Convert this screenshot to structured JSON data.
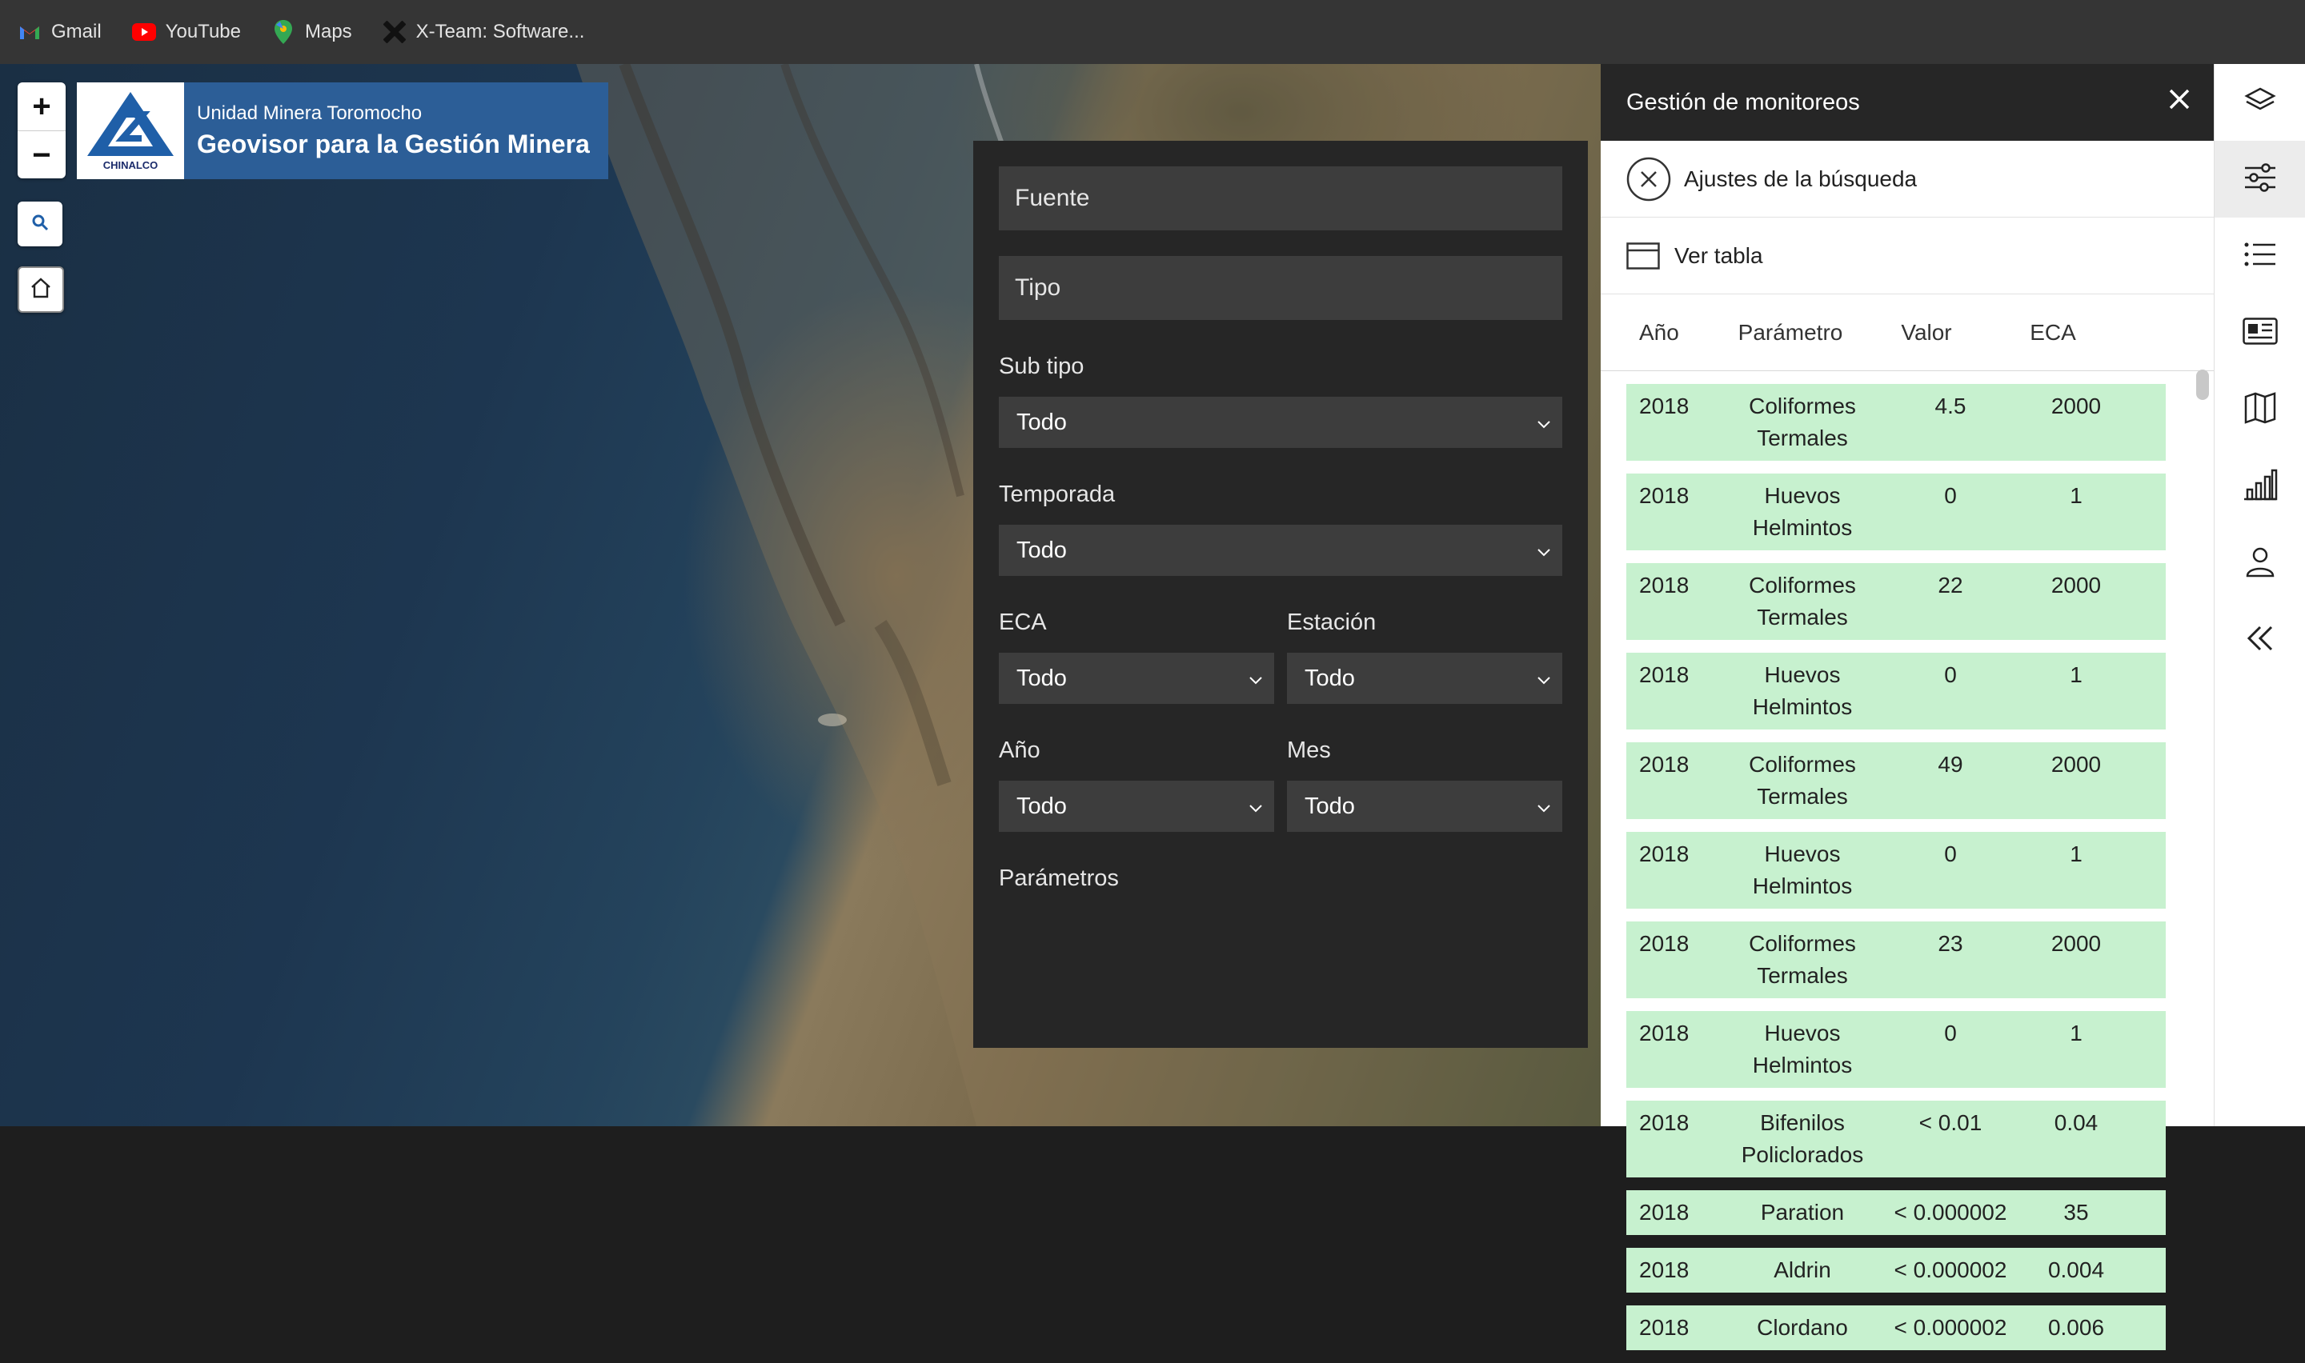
{
  "bookmarks": [
    {
      "label": "Gmail",
      "icon": "gmail-icon"
    },
    {
      "label": "YouTube",
      "icon": "youtube-icon"
    },
    {
      "label": "Maps",
      "icon": "maps-icon"
    },
    {
      "label": "X-Team: Software...",
      "icon": "x-team-icon"
    }
  ],
  "map": {
    "zoom_in": "+",
    "zoom_out": "−",
    "brand": {
      "logo_text": "CHINALCO",
      "subtitle": "Unidad Minera Toromocho",
      "title": "Geovisor para la Gestión Minera"
    }
  },
  "filters": {
    "fuente_placeholder": "Fuente",
    "tipo_placeholder": "Tipo",
    "subtipo_label": "Sub tipo",
    "subtipo_value": "Todo",
    "temporada_label": "Temporada",
    "temporada_value": "Todo",
    "eca_label": "ECA",
    "eca_value": "Todo",
    "estacion_label": "Estación",
    "estacion_value": "Todo",
    "anio_label": "Año",
    "anio_value": "Todo",
    "mes_label": "Mes",
    "mes_value": "Todo",
    "parametros_label": "Parámetros"
  },
  "panel": {
    "title": "Gestión de monitoreos",
    "search_settings": "Ajustes de la búsqueda",
    "view_table": "Ver tabla",
    "columns": [
      "Año",
      "Parámetro",
      "Valor",
      "ECA"
    ],
    "rows": [
      {
        "year": "2018",
        "param": "Coliformes Termales",
        "value": "4.5",
        "eca": "2000"
      },
      {
        "year": "2018",
        "param": "Huevos Helmintos",
        "value": "0",
        "eca": "1"
      },
      {
        "year": "2018",
        "param": "Coliformes Termales",
        "value": "22",
        "eca": "2000"
      },
      {
        "year": "2018",
        "param": "Huevos Helmintos",
        "value": "0",
        "eca": "1"
      },
      {
        "year": "2018",
        "param": "Coliformes Termales",
        "value": "49",
        "eca": "2000"
      },
      {
        "year": "2018",
        "param": "Huevos Helmintos",
        "value": "0",
        "eca": "1"
      },
      {
        "year": "2018",
        "param": "Coliformes Termales",
        "value": "23",
        "eca": "2000"
      },
      {
        "year": "2018",
        "param": "Huevos Helmintos",
        "value": "0",
        "eca": "1"
      },
      {
        "year": "2018",
        "param": "Bifenilos Policlorados",
        "value": "< 0.01",
        "eca": "0.04"
      },
      {
        "year": "2018",
        "param": "Paration",
        "value": "< 0.000002",
        "eca": "35"
      },
      {
        "year": "2018",
        "param": "Aldrin",
        "value": "< 0.000002",
        "eca": "0.004"
      },
      {
        "year": "2018",
        "param": "Clordano",
        "value": "< 0.000002",
        "eca": "0.006"
      }
    ]
  },
  "iconbar": [
    "layers-icon",
    "sliders-icon",
    "list-icon",
    "news-icon",
    "map-icon",
    "bar-chart-icon",
    "user-icon",
    "collapse-icon"
  ]
}
